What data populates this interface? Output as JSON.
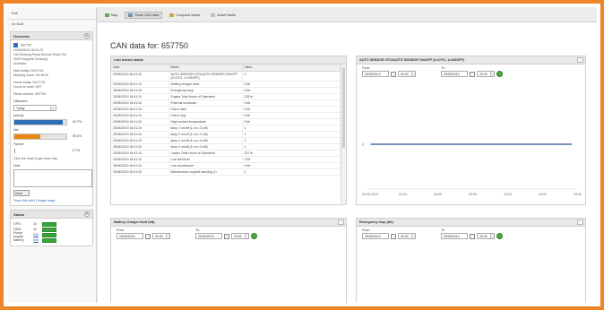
{
  "sidebar": {
    "top_lines": [
      "Exit",
      "on fluid"
    ],
    "overview": {
      "title": "Overview",
      "collapse_label": "+",
      "vehicle_id": "657750",
      "info_lines": [
        "25/06/2019 18:41:23",
        "Old Geelong Road Service Road VIC",
        "3029 Hoppers Crossing",
        "Australia"
      ],
      "work_lines": [
        "Start today: 09:07:00",
        "Working hours: 09:18:00"
      ],
      "hour_lines": [
        "Hours today: 09:07:00",
        "Hours to reset: OFF"
      ],
      "serial": "Serial number: 657750",
      "utilisation_label": "Utilisation",
      "utilisation_value": "Today",
      "activity_label": "Activity",
      "activity_pct_label": "92.7%",
      "activity_pct": 92.7,
      "activity_color": "#2c6fb7",
      "idle_label": "Idle",
      "idle_pct_label": "50.6%",
      "idle_pct": 50.6,
      "idle_color": "#e8860f",
      "parked_label": "Parked",
      "parked_pct_label": "0.7%",
      "parked_pct": 0.7,
      "hint": "Click the chart to get more info.",
      "notes_label": "Note",
      "save_label": "Save",
      "links_text": "Track this unit  |  Google maps"
    },
    "status": {
      "title": "Status",
      "collapse_label": "+",
      "rows": [
        {
          "key": "GPS:",
          "value": "10",
          "link": ""
        },
        {
          "key": "GSM:",
          "value": "31",
          "link": ""
        },
        {
          "key": "Power supply:",
          "value": "",
          "link": "N/A"
        },
        {
          "key": "Battery:",
          "value": "",
          "link": "N/A"
        }
      ]
    }
  },
  "toolbar": {
    "buttons": [
      {
        "label": "Map"
      },
      {
        "label": "Show CAN data"
      },
      {
        "label": "Compare charts"
      },
      {
        "label": "Active faults"
      }
    ]
  },
  "main": {
    "page_title": "CAN data for: 657750",
    "last_known": {
      "title": "Last known status",
      "columns": [
        "Date",
        "Name",
        "Value"
      ],
      "rows": [
        [
          "25/06/2019 18:41:24",
          "AUTO SENSOR OTO/AUTO SENSOR ON/OFF (0=OTO, 1=ONOFF)",
          "0"
        ],
        [
          "25/06/2019 18:41:24",
          "Battery charger fault",
          "0 bit"
        ],
        [
          "25/06/2019 18:41:24",
          "Emergency stop",
          "0 bit"
        ],
        [
          "25/06/2019 18:41:24",
          "Engine Total Hours of Operation",
          "228 hr"
        ],
        [
          "25/06/2019 18:41:24",
          "External shutdown",
          "0 bit"
        ],
        [
          "25/06/2019 18:41:24",
          "Fail to start",
          "0 bit"
        ],
        [
          "25/06/2019 18:41:24",
          "Fail to stop",
          "0 bit"
        ],
        [
          "25/06/2019 18:41:24",
          "High coolant temperature",
          "0 bit"
        ],
        [
          "25/06/2019 18:41:24",
          "lamp 1 on/off (1=on; 0=off)",
          "1"
        ],
        [
          "25/06/2019 18:41:24",
          "lamp 2 on/off (1=on; 0=off)",
          "1"
        ],
        [
          "25/06/2019 18:41:24",
          "lamp 3 on/off (1=on; 0=off)",
          "1"
        ],
        [
          "25/06/2019 18:41:24",
          "lamp 4 on/off (1=on; 0=off)",
          "1"
        ],
        [
          "25/06/2019 18:41:24",
          "Lamps Total Hours of Operation",
          "227 hr"
        ],
        [
          "25/06/2019 18:41:24",
          "Low fuel level",
          "0 bit"
        ],
        [
          "25/06/2019 18:41:24",
          "Low oil pressure",
          "0 bit"
        ],
        [
          "25/06/2019 18:41:24",
          "Maintenance request warning (1=",
          "0"
        ]
      ]
    },
    "auto_sensor": {
      "title": "AUTO SENSOR OTO/AUTO SENSOR ON/OFF (0=OTO, 1=ONOFF)",
      "from_label": "From:",
      "to_label": "To:",
      "from_date": "25/06/2019",
      "from_time": "00:00",
      "to_date": "25/06/2019",
      "to_time": "20:00"
    },
    "battery_charger": {
      "title": "Battery charger fault (bit)",
      "from_label": "From:",
      "to_label": "To:",
      "from_date": "25/06/2019",
      "from_time": "00:00",
      "to_date": "25/06/2019",
      "to_time": "20:00"
    },
    "emergency_stop": {
      "title": "Emergency stop (bit)",
      "from_label": "From:",
      "to_label": "To:",
      "from_date": "25/06/2019",
      "from_time": "00:00",
      "to_date": "25/06/2019",
      "to_time": "20:00"
    }
  },
  "chart_data": {
    "type": "line",
    "title": "",
    "xlabel": "",
    "ylabel": "",
    "x_tick_labels": [
      "25.06.2019",
      "03:00",
      "06:00",
      "09:00",
      "12:00",
      "15:00",
      "18:00"
    ],
    "y_tick_labels": [
      "0"
    ],
    "series": [
      {
        "x": [
          0.3,
          19.5
        ],
        "values": [
          0,
          0
        ]
      }
    ],
    "xlim": [
      0,
      20
    ],
    "ylim": [
      -1,
      1
    ],
    "line_color": "#2c4f9e",
    "grid": false
  },
  "colors": {
    "frame": "#f0842b",
    "accent_blue": "#2c6fb7",
    "accent_orange": "#e8860f",
    "status_green": "#3aa63a"
  }
}
